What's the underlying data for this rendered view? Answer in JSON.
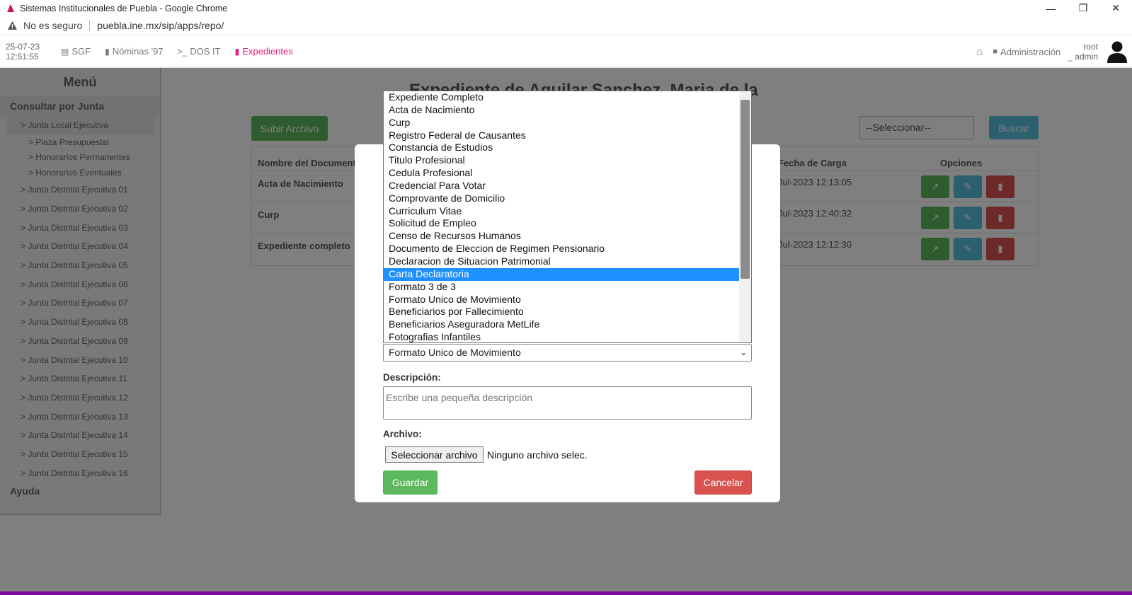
{
  "window": {
    "title": "Sistemas Institucionales de Puebla - Google Chrome",
    "controls": [
      "—",
      "❐",
      "✕"
    ]
  },
  "address": {
    "security": "No es seguro",
    "url": "puebla.ine.mx/sip/apps/repo/"
  },
  "topnav": {
    "date": "25-07-23",
    "time": "12:51:55",
    "items": [
      {
        "label": "SGF",
        "icon": "document-icon"
      },
      {
        "label": "Nóminas '97",
        "icon": "bar-chart-icon"
      },
      {
        "label": "DOS IT",
        "icon": "terminal-icon"
      },
      {
        "label": "Expedientes",
        "icon": "file-icon"
      }
    ],
    "admin_label": "Administración",
    "user_line1": "root",
    "user_line2": "_ admin"
  },
  "sidebar": {
    "title": "Menú",
    "group": "Consultar por Junta",
    "selected_item": "> Junta Local Ejecutiva",
    "subitems": [
      "> Plaza Presupuestal",
      "> Honorarios Permanentes",
      "> Honorarios Eventuales"
    ],
    "items": [
      "> Junta Distrital Ejecutiva 01",
      "> Junta Distrital Ejecutiva 02",
      "> Junta Distrital Ejecutiva 03",
      "> Junta Distrital Ejecutiva 04",
      "> Junta Distrital Ejecutiva 05",
      "> Junta Distrital Ejecutiva 06",
      "> Junta Distrital Ejecutiva 07",
      "> Junta Distrital Ejecutiva 08",
      "> Junta Distrital Ejecutiva 09",
      "> Junta Distrital Ejecutiva 10",
      "> Junta Distrital Ejecutiva 11",
      "> Junta Distrital Ejecutiva 12",
      "> Junta Distrital Ejecutiva 13",
      "> Junta Distrital Ejecutiva 14",
      "> Junta Distrital Ejecutiva 15",
      "> Junta Distrital Ejecutiva 16"
    ],
    "help": "Ayuda"
  },
  "main": {
    "title": "Expediente de Aguilar Sanchez, Maria de la",
    "upload_label": "Subir Archivo",
    "filter_value": "--Seleccionar--",
    "search_label": "Buscar",
    "columns": [
      "Nombre del Documento",
      "Fecha de Carga",
      "Opciones"
    ],
    "rows": [
      {
        "doc": "Acta de Nacimiento",
        "date": "Jul-2023 12:13:05"
      },
      {
        "doc": "Curp",
        "date": "Jul-2023 12:40:32"
      },
      {
        "doc": "Expediente completo",
        "date": "Jul-2023 12:12:30"
      }
    ]
  },
  "modal": {
    "selected_type": "Formato Unico de Movimiento",
    "description_label": "Descripción:",
    "description_placeholder": "Escribe una pequeña descripción",
    "file_label": "Archivo:",
    "file_button": "Seleccionar archivo",
    "file_status": "Ninguno archivo selec.",
    "save_label": "Guardar",
    "cancel_label": "Cancelar"
  },
  "dropdown": {
    "highlighted": "Carta Declaratoria",
    "options": [
      "Expediente Completo",
      "Acta de Nacimiento",
      "Curp",
      "Registro Federal de Causantes",
      "Constancia de Estudios",
      "Titulo Profesional",
      "Cedula Profesional",
      "Credencial Para Votar",
      "Comprovante de Domicilio",
      "Curriculum Vitae",
      "Solicitud de Empleo",
      "Censo de Recursos Humanos",
      "Documento de Eleccion de Regimen Pensionario",
      "Declaracion de Situacion Patrimonial",
      "Carta Declaratoria",
      "Formato 3 de 3",
      "Formato Unico de Movimiento",
      "Beneficiarios por Fallecimiento",
      "Beneficiarios Aseguradora MetLife",
      "Fotografias Infantiles"
    ]
  },
  "colors": {
    "brand": "#e6197a",
    "success": "#5cb85c",
    "info": "#5bc0de",
    "danger": "#d9534f",
    "highlight": "#1e90ff",
    "footer": "#7b0aa0"
  }
}
